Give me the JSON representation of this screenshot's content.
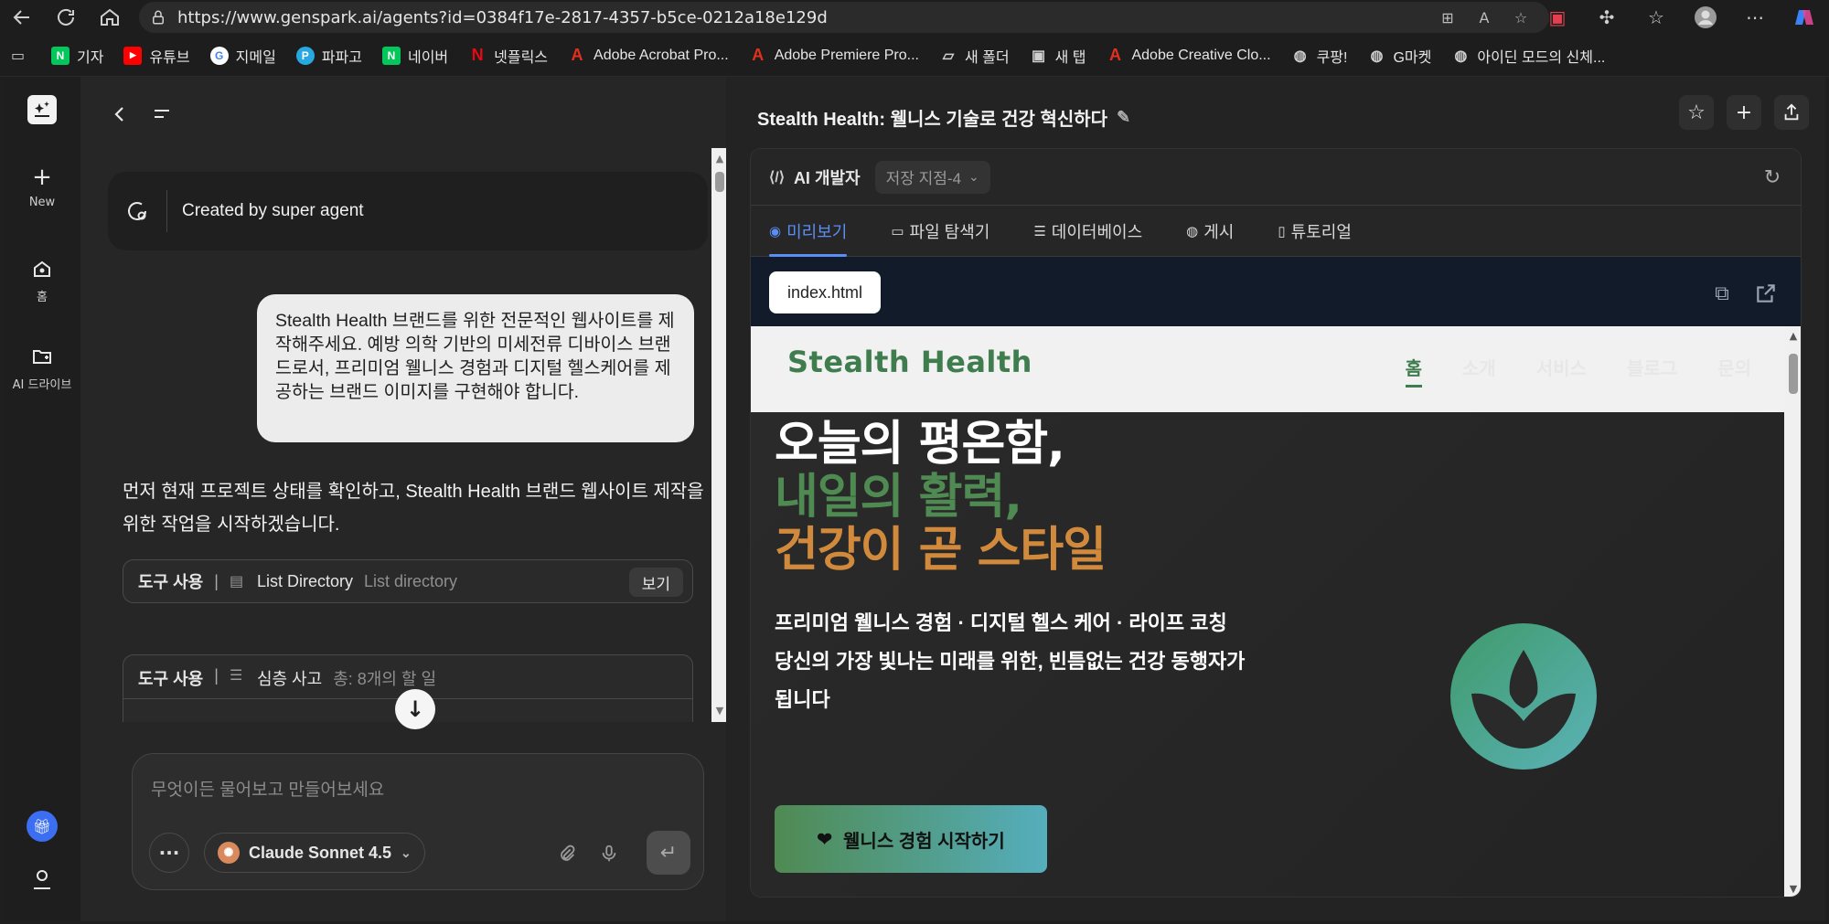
{
  "browser": {
    "url": "https://www.genspark.ai/agents?id=0384f17e-2817-4357-b5ce-0212a18e129d",
    "bookmarks": [
      {
        "label": "기자",
        "icon": "naver-icon",
        "color": "#03c75a"
      },
      {
        "label": "유튜브",
        "icon": "youtube-icon",
        "color": "#ff0000"
      },
      {
        "label": "지메일",
        "icon": "google-icon",
        "color": "#4285f4"
      },
      {
        "label": "파파고",
        "icon": "papago-icon",
        "color": "#28a8e0"
      },
      {
        "label": "네이버",
        "icon": "naver-icon",
        "color": "#03c75a"
      },
      {
        "label": "넷플릭스",
        "icon": "netflix-icon",
        "color": "#e50914"
      },
      {
        "label": "Adobe Acrobat Pro...",
        "icon": "adobe-icon",
        "color": "#e0301e"
      },
      {
        "label": "Adobe Premiere Pro...",
        "icon": "adobe-icon",
        "color": "#e0301e"
      },
      {
        "label": "새 폴더",
        "icon": "folder-icon",
        "color": "#cfcfcf"
      },
      {
        "label": "새 탭",
        "icon": "tab-icon",
        "color": "#cfcfcf"
      },
      {
        "label": "Adobe Creative Clo...",
        "icon": "adobe-icon",
        "color": "#e0301e"
      },
      {
        "label": "쿠팡!",
        "icon": "globe-icon",
        "color": "#cfcfcf"
      },
      {
        "label": "G마켓",
        "icon": "globe-icon",
        "color": "#cfcfcf"
      },
      {
        "label": "아이딘 모드의 신체...",
        "icon": "globe-icon",
        "color": "#cfcfcf"
      }
    ]
  },
  "rail": {
    "new_label": "New",
    "home_label": "홈",
    "drive_label": "AI 드라이브"
  },
  "chat": {
    "created_by": "Created by super agent",
    "user_message": "Stealth Health 브랜드를 위한 전문적인 웹사이트를 제작해주세요. 예방 의학 기반의 미세전류 디바이스 브랜드로서, 프리미엄 웰니스 경험과 디지털 헬스케어를 제공하는 브랜드 이미지를 구현해야 합니다.",
    "assistant_message": "먼저 현재 프로젝트 상태를 확인하고, Stealth Health 브랜드 웹사이트 제작을 위한 작업을 시작하겠습니다.",
    "tool1": {
      "label": "도구 사용",
      "name": "List Directory",
      "desc": "List directory",
      "button": "보기"
    },
    "tool2": {
      "label": "도구 사용",
      "name": "심층 사고",
      "desc": "총: 8개의 할 일"
    },
    "composer_placeholder": "무엇이든 물어보고 만들어보세요",
    "model": "Claude Sonnet 4.5"
  },
  "right": {
    "title": "Stealth Health: 웰니스 기술로 건강 혁신하다",
    "dev_label": "AI 개발자",
    "save_point": "저장 지점-4",
    "tabs": [
      {
        "label": "미리보기",
        "icon": "eye-icon",
        "active": true
      },
      {
        "label": "파일 탐색기",
        "icon": "folder-icon",
        "active": false
      },
      {
        "label": "데이터베이스",
        "icon": "database-icon",
        "active": false
      },
      {
        "label": "게시",
        "icon": "globe-icon",
        "active": false
      },
      {
        "label": "튜토리얼",
        "icon": "book-icon",
        "active": false
      }
    ],
    "file": "index.html"
  },
  "site": {
    "logo": "Stealth Health",
    "menu": [
      "홈",
      "소개",
      "서비스",
      "블로그",
      "문의"
    ],
    "hero_line1": "오늘의 평온함,",
    "hero_line2": "내일의 활력,",
    "hero_line3": "건강이 곧 스타일",
    "sub1": "프리미엄 웰니스 경험 · 디지털 헬스 케어 · 라이프 코칭",
    "sub2": "당신의 가장 빛나는 미래를 위한, 빈틈없는 건강 동행자가 됩니다",
    "cta": "웰니스 경험 시작하기"
  },
  "colors": {
    "brand_green": "#3f7d4f",
    "accent_orange": "#d18a3c",
    "tab_active": "#5b8ef5"
  }
}
